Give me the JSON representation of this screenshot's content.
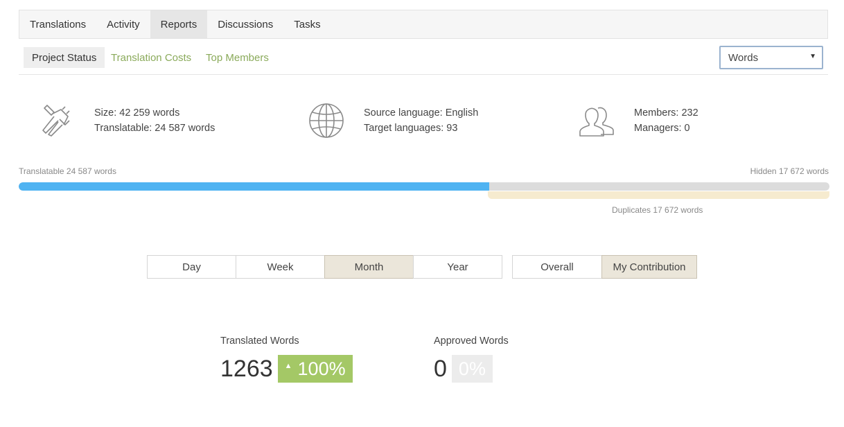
{
  "tabs": [
    "Translations",
    "Activity",
    "Reports",
    "Discussions",
    "Tasks"
  ],
  "active_tab": "Reports",
  "subtabs": [
    "Project Status",
    "Translation Costs",
    "Top Members"
  ],
  "active_subtab": "Project Status",
  "unit_select": {
    "value": "Words"
  },
  "info": {
    "size": "Size: 42 259 words",
    "translatable": "Translatable: 24 587 words",
    "source_language": "Source language: English",
    "target_languages": "Target languages: 93",
    "members": "Members: 232",
    "managers": "Managers: 0"
  },
  "progress": {
    "translatable_label": "Translatable 24 587 words",
    "hidden_label": "Hidden 17 672 words",
    "duplicates_label": "Duplicates 17 672 words",
    "translatable_fraction": 0.58
  },
  "periods": [
    "Day",
    "Week",
    "Month",
    "Year"
  ],
  "active_period": "Month",
  "scopes": [
    "Overall",
    "My Contribution"
  ],
  "active_scope": "My Contribution",
  "stats": {
    "translated": {
      "title": "Translated Words",
      "value": "1263",
      "percent": "100%"
    },
    "approved": {
      "title": "Approved Words",
      "value": "0",
      "percent": "0%"
    }
  },
  "colors": {
    "progress_fill": "#4fb3f2",
    "accent_green": "#a4c866",
    "link_green": "#8aaa5a",
    "duplicates": "#f6ebcf"
  },
  "icons": [
    "caliper-icon",
    "globe-icon",
    "members-icon",
    "triangle-up-icon"
  ]
}
